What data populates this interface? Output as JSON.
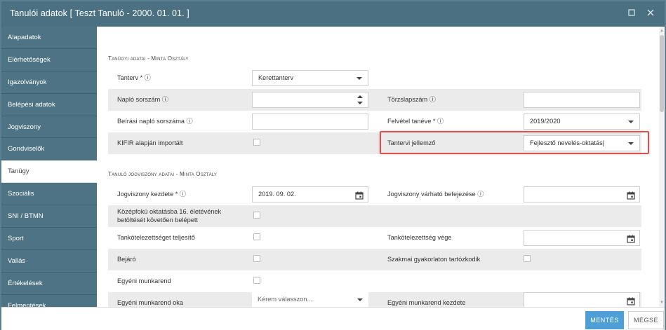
{
  "window": {
    "title": "Tanulói adatok [ Teszt Tanuló - 2000. 01. 01. ]",
    "maximize_icon": "maximize-icon",
    "close_icon": "close-icon"
  },
  "sidebar": {
    "items": [
      {
        "label": "Alapadatok"
      },
      {
        "label": "Elérhetőségek"
      },
      {
        "label": "Igazolványok"
      },
      {
        "label": "Belépési adatok"
      },
      {
        "label": "Jogviszony"
      },
      {
        "label": "Gondviselők"
      },
      {
        "label": "Tanügy",
        "active": true
      },
      {
        "label": "Szociális"
      },
      {
        "label": "SNI / BTMN"
      },
      {
        "label": "Sport"
      },
      {
        "label": "Vallás"
      },
      {
        "label": "Értékelések"
      },
      {
        "label": "Felmentések"
      }
    ]
  },
  "sections": {
    "tanugyi": {
      "title": "Tanügyi adatai - Minta Osztály",
      "tanterv_label": "Tanterv * ⓘ",
      "tanterv_value": "Kerettanterv",
      "naplo_label": "Napló sorszám ⓘ",
      "naplo_value": "",
      "torzslap_label": "Törzslapszám ⓘ",
      "torzslap_value": "",
      "beirasi_label": "Beírási napló sorszáma ⓘ",
      "beirasi_value": "",
      "felvetel_label": "Felvétel tanéve * ⓘ",
      "felvetel_value": "2019/2020",
      "kifir_label": "KIFIR alapján importált",
      "tantervi_label": "Tantervi jellemző",
      "tantervi_value": "Fejlesztő nevelés-oktatás"
    },
    "jogviszony": {
      "title": "Tanuló jogviszony adatai - Minta Osztály",
      "kezdete_label": "Jogviszony kezdete * ⓘ",
      "kezdete_value": "2019. 09. 02.",
      "varhato_label": "Jogviszony várható befejezése ⓘ",
      "varhato_value": "",
      "kozepfoku_label_line1": "Középfokú oktatásba 16. életévének",
      "kozepfoku_label_line2": "betöltését követően belépett",
      "tankot_label": "Tankötelezettséget teljesítő",
      "tankot_vege_label": "Tankötelezettség vége",
      "tankot_vege_value": "",
      "bejaro_label": "Bejáró",
      "szakmai_label": "Szakmai gyakorlaton tartózkodik",
      "egyeni_label": "Egyéni munkarend",
      "egyeni_oka_label": "Egyéni munkarend oka",
      "egyeni_oka_placeholder": "Kérem válasszon...",
      "egyeni_kezdete_label": "Egyéni munkarend kezdete",
      "egyeni_kezdete_value": ""
    }
  },
  "footer": {
    "save_label": "MENTÉS",
    "cancel_label": "MÉGSE"
  },
  "colors": {
    "titlebar": "#4a7081",
    "sidebar": "#4e7385",
    "primary_button": "#4e9fd6",
    "highlight": "#d9534f"
  }
}
